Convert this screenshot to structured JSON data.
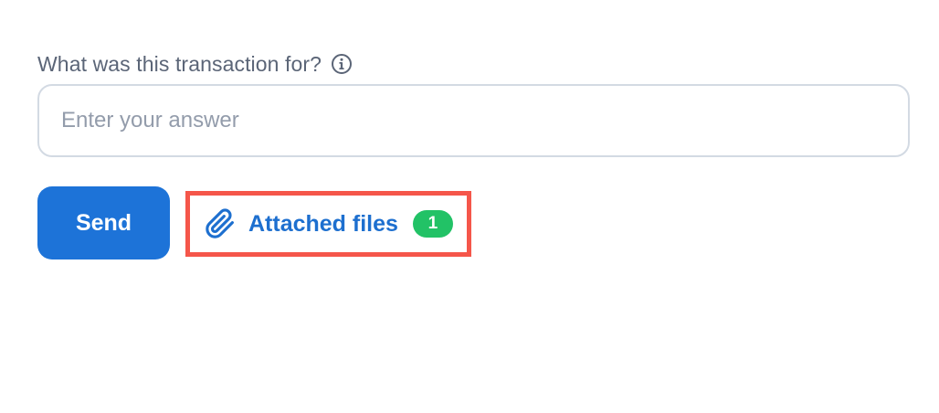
{
  "question": {
    "label": "What was this transaction for?",
    "info_icon": "info-icon"
  },
  "answer": {
    "value": "",
    "placeholder": "Enter your answer"
  },
  "actions": {
    "send_label": "Send",
    "attached_files_label": "Attached files",
    "attached_files_count": "1",
    "attachment_icon": "paperclip-icon"
  },
  "colors": {
    "primary": "#1d73d8",
    "link": "#1d6fcf",
    "badge": "#22c266",
    "highlight": "#f5564a",
    "input_border": "#d3dae3"
  }
}
